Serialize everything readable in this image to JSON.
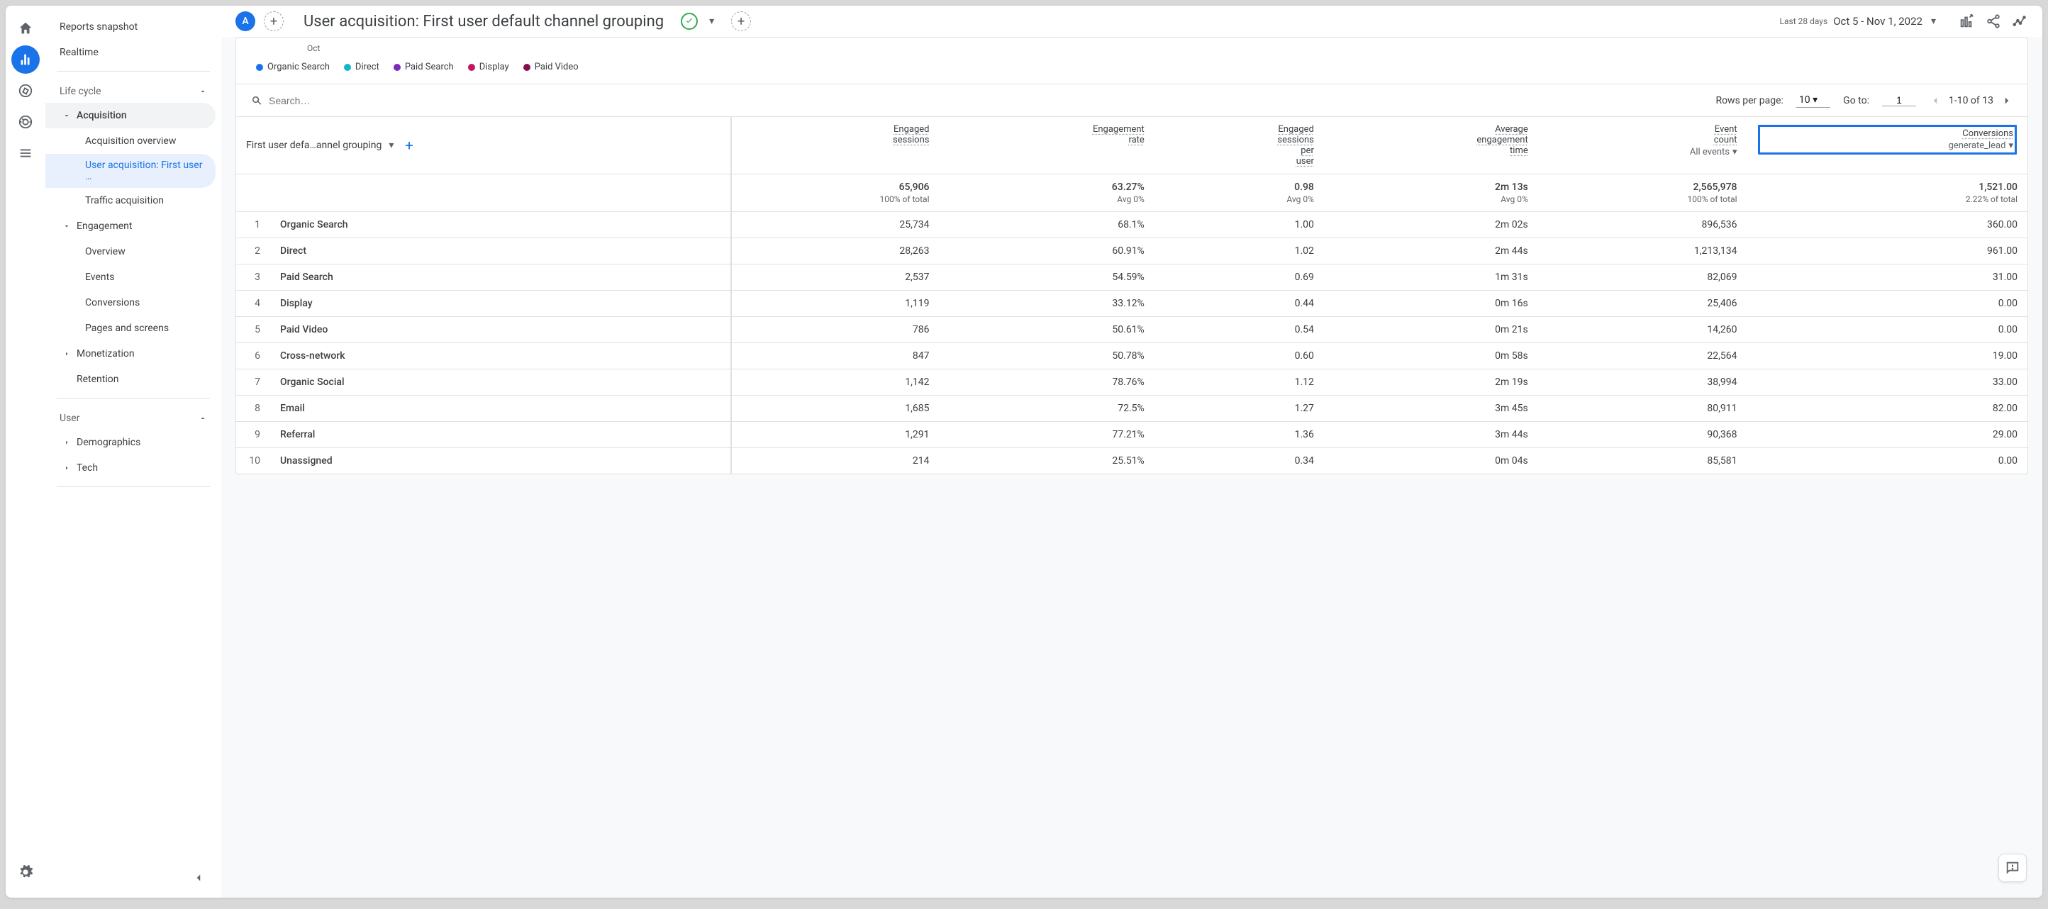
{
  "sidebar": {
    "top": [
      "Reports snapshot",
      "Realtime"
    ],
    "sections": [
      {
        "title": "Life cycle",
        "groups": [
          {
            "name": "Acquisition",
            "expanded": true,
            "items": [
              "Acquisition overview",
              "User acquisition: First user …",
              "Traffic acquisition"
            ],
            "active_index": 1
          },
          {
            "name": "Engagement",
            "expanded": true,
            "items": [
              "Overview",
              "Events",
              "Conversions",
              "Pages and screens"
            ]
          },
          {
            "name": "Monetization",
            "expanded": false
          },
          {
            "name": "Retention",
            "expanded": false,
            "leaf": true
          }
        ]
      },
      {
        "title": "User",
        "groups": [
          {
            "name": "Demographics",
            "expanded": false
          },
          {
            "name": "Tech",
            "expanded": false
          }
        ]
      }
    ]
  },
  "header": {
    "chip": "A",
    "title": "User acquisition: First user default channel grouping",
    "date_label": "Last 28 days",
    "date_value": "Oct 5 - Nov 1, 2022"
  },
  "chart": {
    "month": "Oct",
    "legend": [
      {
        "label": "Organic Search",
        "color": "#1a73e8"
      },
      {
        "label": "Direct",
        "color": "#12b5cb"
      },
      {
        "label": "Paid Search",
        "color": "#7b2cbf"
      },
      {
        "label": "Display",
        "color": "#c2185b"
      },
      {
        "label": "Paid Video",
        "color": "#880e4f"
      }
    ]
  },
  "toolbar": {
    "search_placeholder": "Search…",
    "rows_per_page_label": "Rows per page:",
    "rows_per_page_value": "10",
    "goto_label": "Go to:",
    "goto_value": "1",
    "range": "1-10 of 13"
  },
  "table": {
    "dimension_label": "First user defa…annel grouping",
    "columns": [
      {
        "label": "Engaged sessions"
      },
      {
        "label": "Engagement rate"
      },
      {
        "label": "Engaged sessions per user"
      },
      {
        "label": "Average engagement time"
      },
      {
        "label": "Event count",
        "sub": "All events"
      },
      {
        "label": "Conversions",
        "sub": "generate_lead",
        "highlight": true
      }
    ],
    "totals": {
      "values": [
        "65,906",
        "63.27%",
        "0.98",
        "2m 13s",
        "2,565,978",
        "1,521.00"
      ],
      "subs": [
        "100% of total",
        "Avg 0%",
        "Avg 0%",
        "Avg 0%",
        "100% of total",
        "2.22% of total"
      ]
    },
    "rows": [
      {
        "idx": 1,
        "name": "Organic Search",
        "v": [
          "25,734",
          "68.1%",
          "1.00",
          "2m 02s",
          "896,536",
          "360.00"
        ]
      },
      {
        "idx": 2,
        "name": "Direct",
        "v": [
          "28,263",
          "60.91%",
          "1.02",
          "2m 44s",
          "1,213,134",
          "961.00"
        ]
      },
      {
        "idx": 3,
        "name": "Paid Search",
        "v": [
          "2,537",
          "54.59%",
          "0.69",
          "1m 31s",
          "82,069",
          "31.00"
        ]
      },
      {
        "idx": 4,
        "name": "Display",
        "v": [
          "1,119",
          "33.12%",
          "0.44",
          "0m 16s",
          "25,406",
          "0.00"
        ]
      },
      {
        "idx": 5,
        "name": "Paid Video",
        "v": [
          "786",
          "50.61%",
          "0.54",
          "0m 21s",
          "14,260",
          "0.00"
        ]
      },
      {
        "idx": 6,
        "name": "Cross-network",
        "v": [
          "847",
          "50.78%",
          "0.60",
          "0m 58s",
          "22,564",
          "19.00"
        ]
      },
      {
        "idx": 7,
        "name": "Organic Social",
        "v": [
          "1,142",
          "78.76%",
          "1.12",
          "2m 19s",
          "38,994",
          "33.00"
        ]
      },
      {
        "idx": 8,
        "name": "Email",
        "v": [
          "1,685",
          "72.5%",
          "1.27",
          "3m 45s",
          "80,911",
          "82.00"
        ]
      },
      {
        "idx": 9,
        "name": "Referral",
        "v": [
          "1,291",
          "77.21%",
          "1.36",
          "3m 44s",
          "90,368",
          "29.00"
        ]
      },
      {
        "idx": 10,
        "name": "Unassigned",
        "v": [
          "214",
          "25.51%",
          "0.34",
          "0m 04s",
          "85,581",
          "0.00"
        ]
      }
    ]
  }
}
